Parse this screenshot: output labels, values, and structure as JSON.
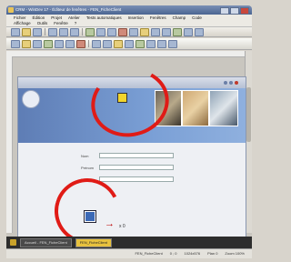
{
  "window": {
    "title": "CRM - WinDev 17 - Éditeur de fenêtres - FEN_FicheClient"
  },
  "menu": {
    "row1": [
      "Fichier",
      "Édition",
      "Projet",
      "Atelier",
      "Tests automatiques",
      "Insertion",
      "Fenêtres",
      "Champ",
      "Code"
    ],
    "row2": [
      "Affichage",
      "Outils",
      "Fenêtre",
      "?"
    ]
  },
  "form": {
    "fields": [
      {
        "label": "Nom"
      },
      {
        "label": "Prénom"
      },
      {
        "label": "Email"
      }
    ]
  },
  "canvas": {
    "bottom_label": "Valider",
    "small_text": "x 0"
  },
  "taskbar": {
    "items": [
      {
        "label": "Accueil - FEN_FicheClient",
        "active": false
      },
      {
        "label": "FEN_FicheClient",
        "active": true
      }
    ]
  },
  "statusbar": {
    "items": [
      "FEN_FicheClient",
      "0 ; 0",
      "1024x576",
      "Plan 0",
      "Zoom 100%"
    ]
  },
  "colors": {
    "annotation_circle": "#e01b16",
    "selection_handle": "#f2d52c",
    "banner": "#6b8fc7"
  }
}
